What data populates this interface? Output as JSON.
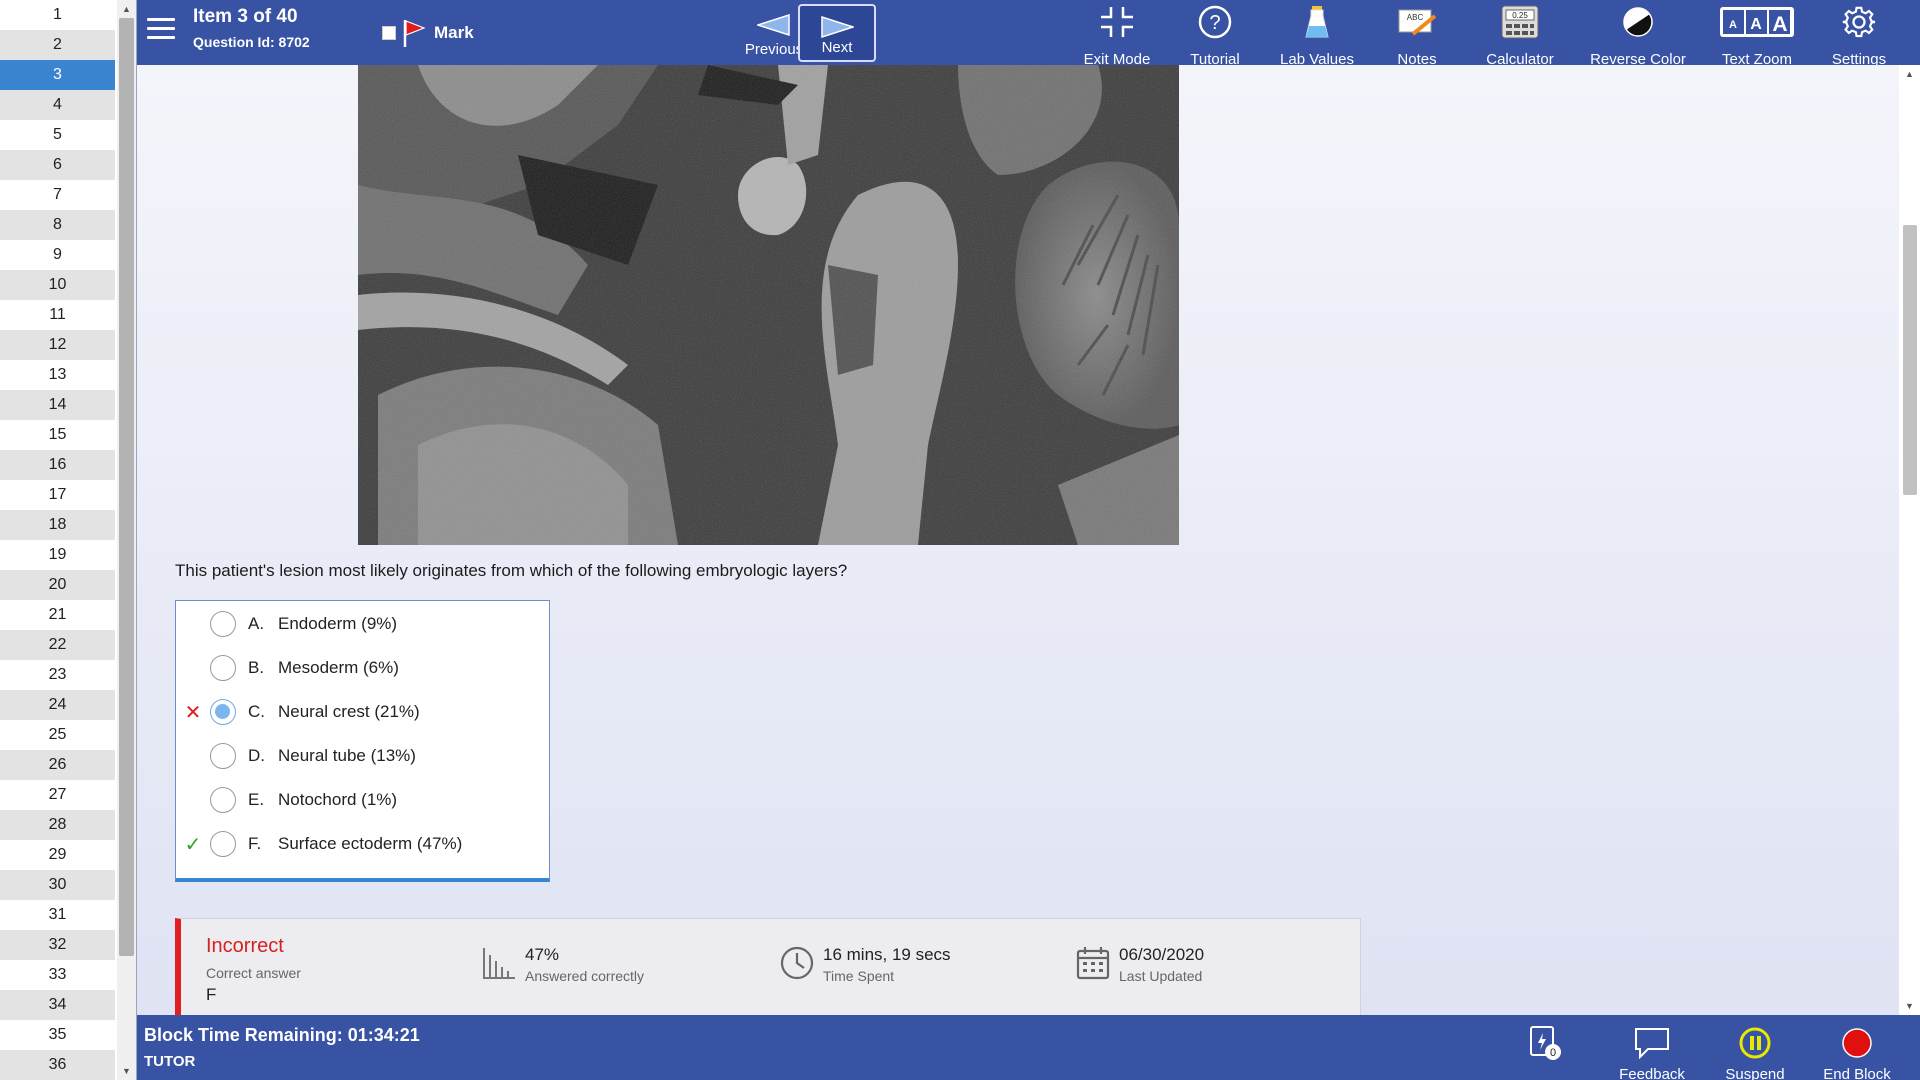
{
  "sidebar": {
    "items": [
      "1",
      "2",
      "3",
      "4",
      "5",
      "6",
      "7",
      "8",
      "9",
      "10",
      "11",
      "12",
      "13",
      "14",
      "15",
      "16",
      "17",
      "18",
      "19",
      "20",
      "21",
      "22",
      "23",
      "24",
      "25",
      "26",
      "27",
      "28",
      "29",
      "30",
      "31",
      "32",
      "33",
      "34",
      "35",
      "36"
    ],
    "current": "3"
  },
  "header": {
    "item_title": "Item 3 of 40",
    "question_id": "Question Id: 8702",
    "mark_label": "Mark",
    "previous_label": "Previous",
    "next_label": "Next",
    "tools": {
      "exit_mode": "Exit Mode",
      "tutorial": "Tutorial",
      "lab_values": "Lab Values",
      "notes": "Notes",
      "calculator": "Calculator",
      "calculator_display": "0.25",
      "notes_icon_text": "ABC",
      "reverse_color": "Reverse Color",
      "text_zoom": "Text Zoom",
      "text_zoom_letters": [
        "A",
        "A",
        "A"
      ],
      "settings": "Settings"
    }
  },
  "question": {
    "stem": "This patient's lesion most likely originates from which of the following embryologic layers?",
    "answers": [
      {
        "letter": "A.",
        "text": "Endoderm (9%)",
        "selected": false,
        "status": ""
      },
      {
        "letter": "B.",
        "text": "Mesoderm (6%)",
        "selected": false,
        "status": ""
      },
      {
        "letter": "C.",
        "text": "Neural crest (21%)",
        "selected": true,
        "status": "incorrect"
      },
      {
        "letter": "D.",
        "text": "Neural tube (13%)",
        "selected": false,
        "status": ""
      },
      {
        "letter": "E.",
        "text": "Notochord (1%)",
        "selected": false,
        "status": ""
      },
      {
        "letter": "F.",
        "text": "Surface ectoderm (47%)",
        "selected": false,
        "status": "correct"
      }
    ]
  },
  "result": {
    "status": "Incorrect",
    "correct_label": "Correct answer",
    "correct_letter": "F",
    "percent_value": "47%",
    "percent_label": "Answered correctly",
    "time_value": "16 mins, 19 secs",
    "time_label": "Time Spent",
    "date_value": "06/30/2020",
    "date_label": "Last Updated"
  },
  "footer": {
    "timer": "Block Time Remaining: 01:34:21",
    "mode": "TUTOR",
    "flash_count": "0",
    "feedback": "Feedback",
    "suspend": "Suspend",
    "end_block": "End Block"
  },
  "colors": {
    "bar": "#3852a4",
    "selected_row": "#3b84cf",
    "incorrect": "#e02020",
    "correct": "#2aa52a",
    "suspend": "#e8e800",
    "end_block": "#e01010"
  },
  "icons": {
    "menu": "hamburger-icon",
    "mark": "flag-icon",
    "exit_mode": "compress-icon",
    "tutorial": "question-circle-icon",
    "lab_values": "flask-icon",
    "notes": "notepad-icon",
    "calculator": "calculator-icon",
    "reverse_color": "contrast-icon",
    "settings": "gear-icon",
    "stat_percent": "bar-chart-icon",
    "stat_time": "clock-icon",
    "stat_date": "calendar-icon",
    "flashcard": "flashcard-icon",
    "feedback": "speech-bubble-icon",
    "suspend": "pause-icon",
    "end_block": "stop-icon"
  }
}
